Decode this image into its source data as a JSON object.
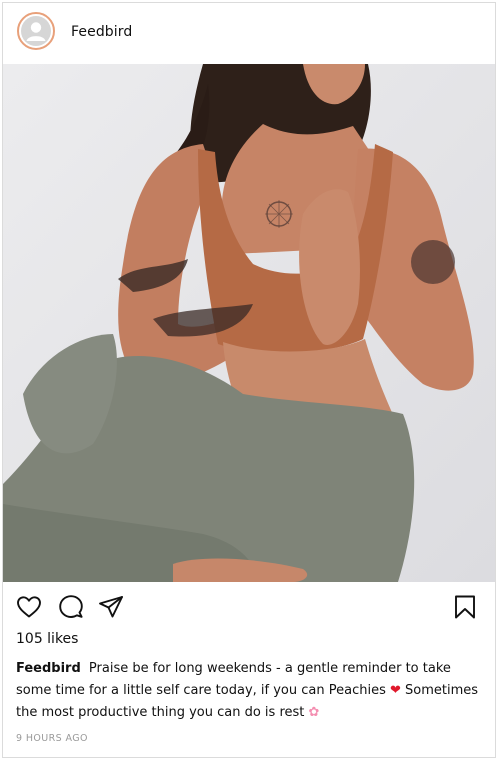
{
  "post": {
    "username": "Feedbird",
    "likes": "105 likes",
    "caption_user": "Feedbird",
    "caption_line1": "Praise be for long weekends - a gentle reminder to take some time for a little self care today, if you can Peachies",
    "caption_emoji1": "❤",
    "caption_line2": "Sometimes the most productive thing you can do is rest",
    "caption_emoji2": "✿",
    "timestamp": "9 HOURS AGO"
  },
  "icons": {
    "avatar": "user-placeholder-icon",
    "like": "heart-icon",
    "comment": "comment-icon",
    "share": "paper-plane-icon",
    "save": "bookmark-icon"
  },
  "colors": {
    "avatar_ring": "#e8a07a",
    "heart_emoji": "#e0192c",
    "timestamp": "#9a9a9a",
    "border": "#dbdbdb"
  }
}
